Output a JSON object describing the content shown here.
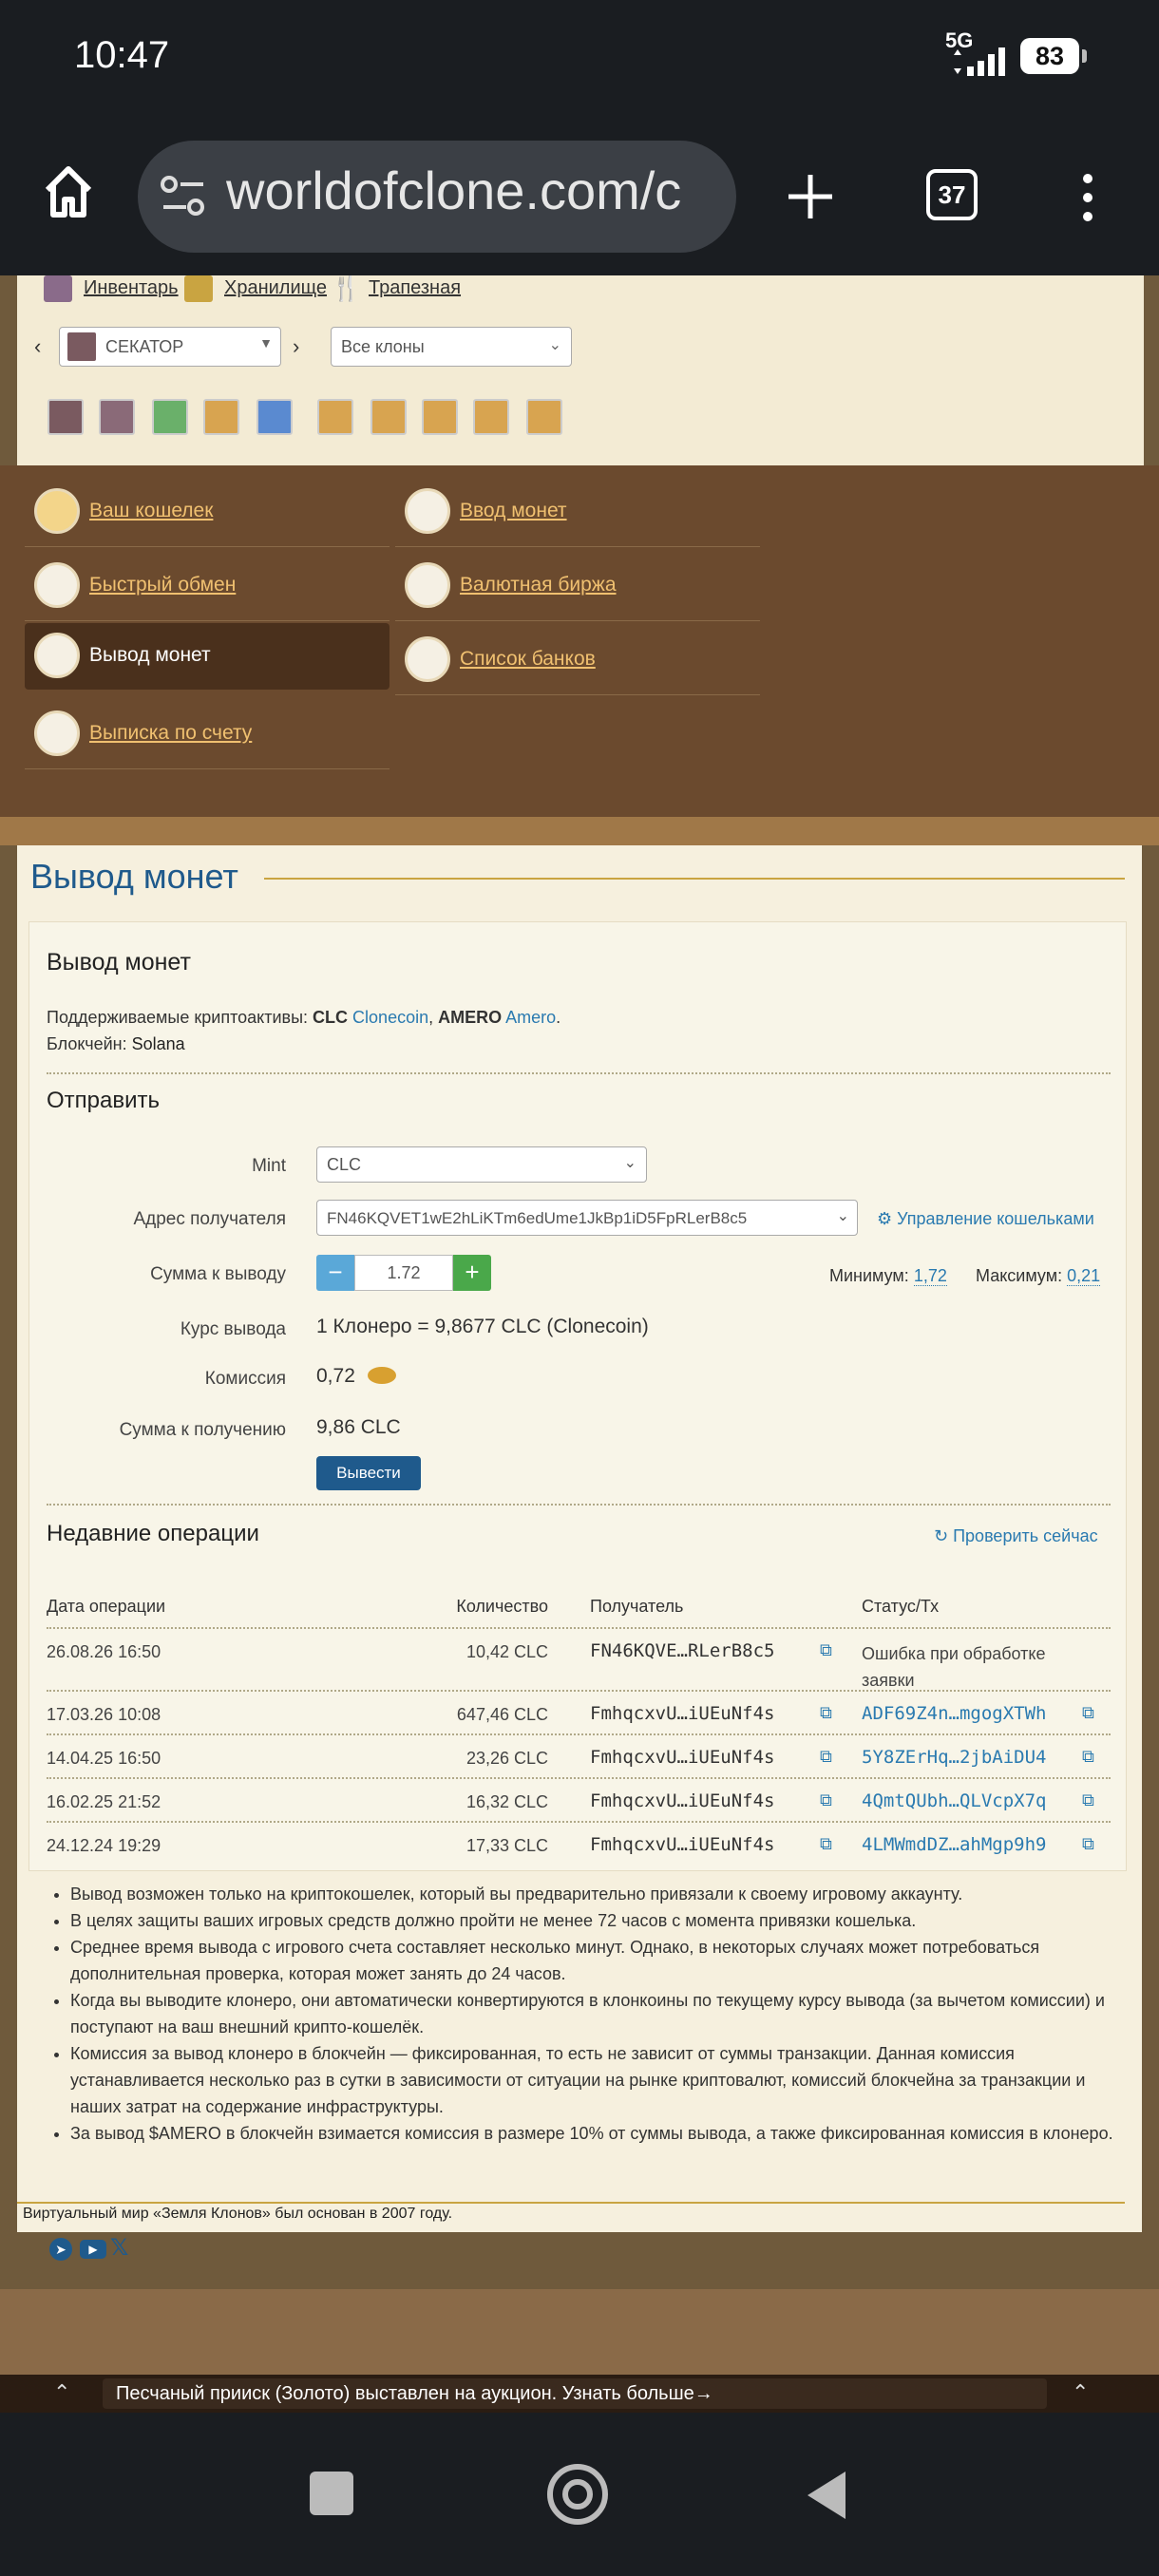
{
  "status": {
    "time": "10:47",
    "network": "5G",
    "battery": "83"
  },
  "browser": {
    "url": "worldofclone.com/c",
    "tabs": "37"
  },
  "top_nav": {
    "inventory": "Инвентарь",
    "storage": "Хранилище",
    "dining": "Трапезная"
  },
  "clone_select": {
    "value": "СЕКАТОР"
  },
  "clone_filter": {
    "value": "Все клоны"
  },
  "menu": {
    "wallet": "Ваш кошелек",
    "deposit": "Ввод монет",
    "exchange": "Быстрый обмен",
    "currency": "Валютная биржа",
    "withdraw": "Вывод монет",
    "banks": "Список банков",
    "statement": "Выписка по счету"
  },
  "page_title": "Вывод монет",
  "card": {
    "title": "Вывод монет",
    "supported_prefix": "Поддерживаемые криптоактивы:",
    "clc": "CLC",
    "clonecoin": "Clonecoin",
    "amero": "AMERO",
    "amero_link": "Amero",
    "blockchain_label": "Блокчейн:",
    "blockchain": "Solana",
    "send_title": "Отправить",
    "mint_label": "Mint",
    "mint_value": "CLC",
    "address_label": "Адрес получателя",
    "address_value": "FN46KQVET1wE2hLiKTm6edUme1JkBp1iD5FpRLerB8c5",
    "manage_wallets": "Управление кошельками",
    "amount_label": "Сумма к выводу",
    "amount_value": "1.72",
    "min_label": "Минимум:",
    "min_value": "1,72",
    "max_label": "Максимум:",
    "max_value": "0,21",
    "rate_label": "Курс вывода",
    "rate_value": "1 Клонеро = 9,8677 CLC (Clonecoin)",
    "fee_label": "Комиссия",
    "fee_value": "0,72",
    "receive_label": "Сумма к получению",
    "receive_value": "9,86 CLC",
    "submit": "Вывести",
    "recent_title": "Недавние операции",
    "check_now": "Проверить сейчас"
  },
  "table": {
    "headers": [
      "Дата операции",
      "Количество",
      "Получатель",
      "Статус/Тх"
    ],
    "rows": [
      {
        "date": "26.08.26 16:50",
        "amount": "10,42 CLC",
        "recipient": "FN46KQVE…RLerB8c5",
        "status": "Ошибка при обработке заявки"
      },
      {
        "date": "17.03.26 10:08",
        "amount": "647,46 CLC",
        "recipient": "FmhqcxvU…iUEuNf4s",
        "status": "ADF69Z4n…mgogXTWh"
      },
      {
        "date": "14.04.25 16:50",
        "amount": "23,26 CLC",
        "recipient": "FmhqcxvU…iUEuNf4s",
        "status": "5Y8ZErHq…2jbAiDU4"
      },
      {
        "date": "16.02.25 21:52",
        "amount": "16,32 CLC",
        "recipient": "FmhqcxvU…iUEuNf4s",
        "status": "4QmtQUbh…QLVcpX7q"
      },
      {
        "date": "24.12.24 19:29",
        "amount": "17,33 CLC",
        "recipient": "FmhqcxvU…iUEuNf4s",
        "status": "4LMWmdDZ…ahMgp9h9"
      }
    ]
  },
  "notes": [
    "Вывод возможен только на криптокошелек, который вы предварительно привязали к своему игровому аккаунту.",
    "В целях защиты ваших игровых средств должно пройти не менее 72 часов с момента привязки кошелька.",
    "Среднее время вывода с игрового счета составляет несколько минут. Однако, в некоторых случаях может потребоваться дополнительная проверка, которая может занять до 24 часов.",
    "Когда вы выводите клонеро, они автоматически конвертируются в клонкоины по текущему курсу вывода (за вычетом комиссии) и поступают на ваш внешний крипто-кошелёк.",
    "Комиссия за вывод клонеро в блокчейн — фиксированная, то есть не зависит от суммы транзакции. Данная комиссия устанавливается несколько раз в сутки в зависимости от ситуации на рынке криптовалют, комиссий блокчейна за транзакции и наших затрат на содержание инфраструктуры.",
    "За вывод $AMERO в блокчейн взимается комиссия в размере 10% от суммы вывода, а также фиксированная комиссия в клонеро."
  ],
  "footer": {
    "text": "Виртуальный мир «Земля Клонов» был основан в 2007 году."
  },
  "ticker": {
    "text": "Песчаный прииск (Золото) выставлен на аукцион. Узнать больше→"
  },
  "colors": {
    "accent": "#2a7ab0",
    "menu_bg": "#6b4a2e",
    "menu_link": "#f0c070",
    "button": "#1f5a8c"
  }
}
